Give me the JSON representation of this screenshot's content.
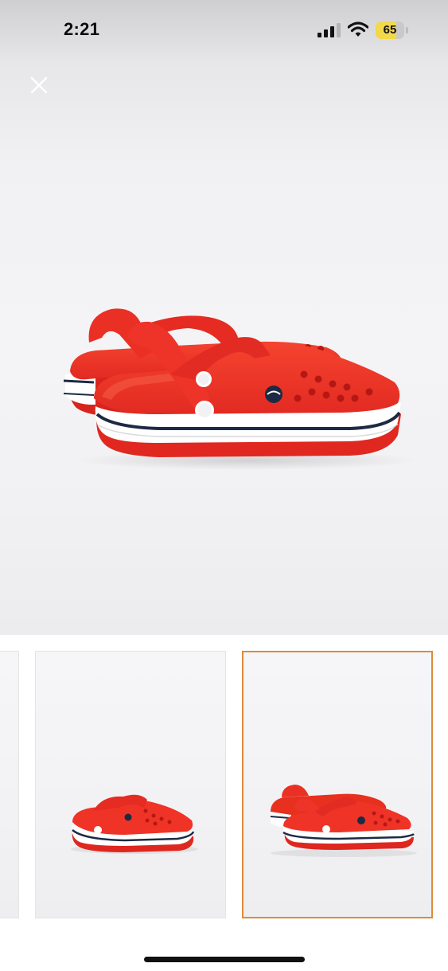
{
  "status_bar": {
    "time": "2:21",
    "battery_level": "65",
    "signal_icon": "cellular-signal-icon",
    "wifi_icon": "wifi-icon",
    "battery_icon": "battery-icon"
  },
  "viewer": {
    "close_icon": "close-icon",
    "main_image": "red-clog-pair-side-view",
    "thumbnails": [
      {
        "image": "red-clog-previous-image",
        "selected": false
      },
      {
        "image": "red-clog-single-angled-view",
        "selected": false
      },
      {
        "image": "red-clog-pair-side-view",
        "selected": true
      }
    ]
  },
  "colors": {
    "clog_red": "#ee2f26",
    "selection_border": "#e08a3c",
    "stripe_navy": "#1d2a44"
  }
}
